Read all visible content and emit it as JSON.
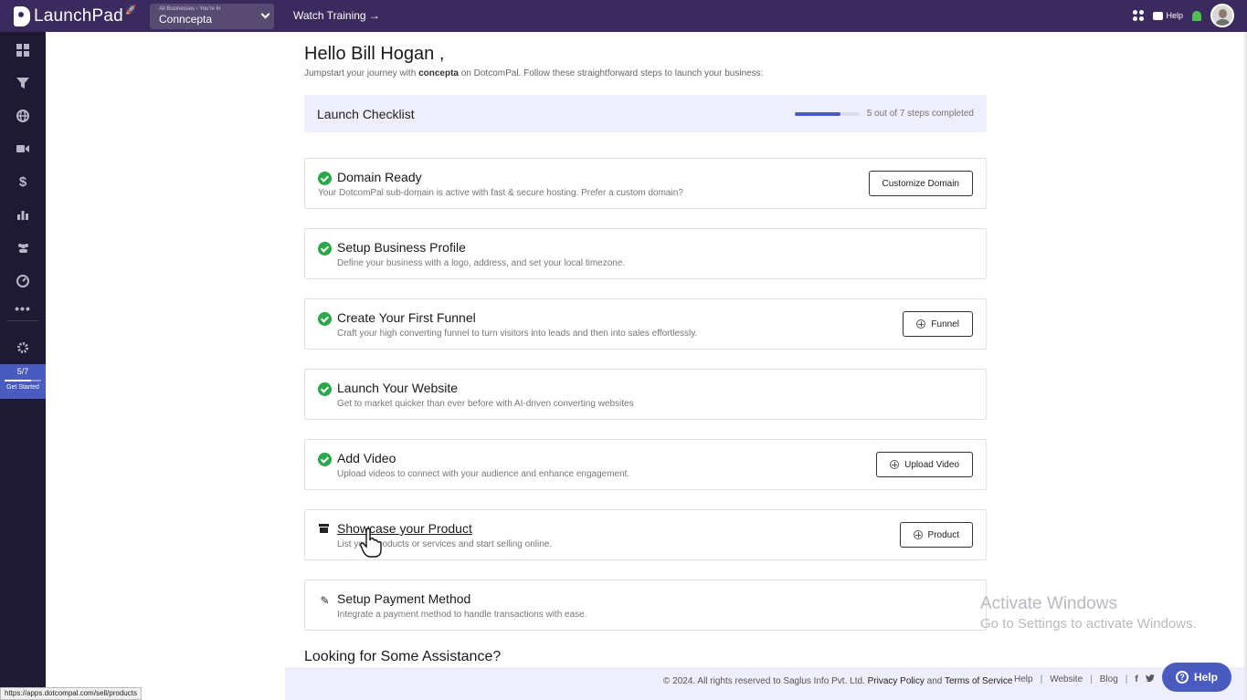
{
  "topbar": {
    "brand": "LaunchPad",
    "business_breadcrumb": "All Businesses › You're In",
    "business_name": "Conncepta",
    "watch_training": "Watch Training →",
    "help_label": "Help"
  },
  "sidebar": {
    "items": [
      "dashboard-icon",
      "funnel-icon",
      "globe-icon",
      "video-icon",
      "dollar-icon",
      "chart-icon",
      "users-icon",
      "gauge-icon",
      "more-icon",
      "settings-icon"
    ],
    "progress_text": "5/7",
    "progress_value": 0.714,
    "get_started": "Get Started"
  },
  "main": {
    "greeting": "Hello Bill Hogan ,",
    "intro_pre": "Jumpstart your journey with ",
    "intro_bold": "concepta",
    "intro_post": " on DotcomPal. Follow these straightforward steps to launch your business:",
    "checklist_title": "Launch Checklist",
    "progress_text": "5 out of 7 steps completed",
    "progress_fraction": 0.714,
    "steps": [
      {
        "title": "Domain Ready",
        "desc": "Your DotcomPal sub-domain is active with fast & secure hosting. Prefer a custom domain?",
        "button": "Customize Domain",
        "done": true
      },
      {
        "title": "Setup Business Profile",
        "desc": "Define your business with a logo, address, and set your local timezone.",
        "button": "",
        "done": true
      },
      {
        "title": "Create Your First Funnel",
        "desc": "Craft your high converting funnel to turn visitors into leads and then into sales effortlessly.",
        "button": "Funnel",
        "done": true
      },
      {
        "title": "Launch Your Website",
        "desc": "Get to market quicker than ever before with AI-driven converting websites",
        "button": "",
        "done": true
      },
      {
        "title": "Add Video",
        "desc": "Upload videos to connect with your audience and enhance engagement.",
        "button": "Upload Video",
        "done": true
      },
      {
        "title": "Showcase your Product",
        "desc": "List your products or services and start selling online.",
        "button": "Product",
        "done": false
      },
      {
        "title": "Setup Payment Method",
        "desc": "Integrate a payment method to handle transactions with ease.",
        "button": "",
        "done": false
      }
    ],
    "assistance_title": "Looking for Some Assistance?"
  },
  "footer": {
    "copyright": "©  2024. All rights reserved to Saglus Info Pvt. Ltd.",
    "privacy": "Privacy Policy",
    "and": "and",
    "terms": "Terms of Service",
    "links": [
      "Help",
      "Website",
      "Blog"
    ],
    "social": [
      "f",
      "twitter-icon"
    ]
  },
  "help_fab": "Help",
  "watermark": {
    "line1": "Activate Windows",
    "line2": "Go to Settings to activate Windows."
  },
  "status_url": "https://apps.dotcompal.com/sell/products",
  "colors": {
    "topbar": "#3a2a5e",
    "sidebar": "#1e1a33",
    "accent": "#4a5bbf",
    "success": "#2aa84a"
  }
}
